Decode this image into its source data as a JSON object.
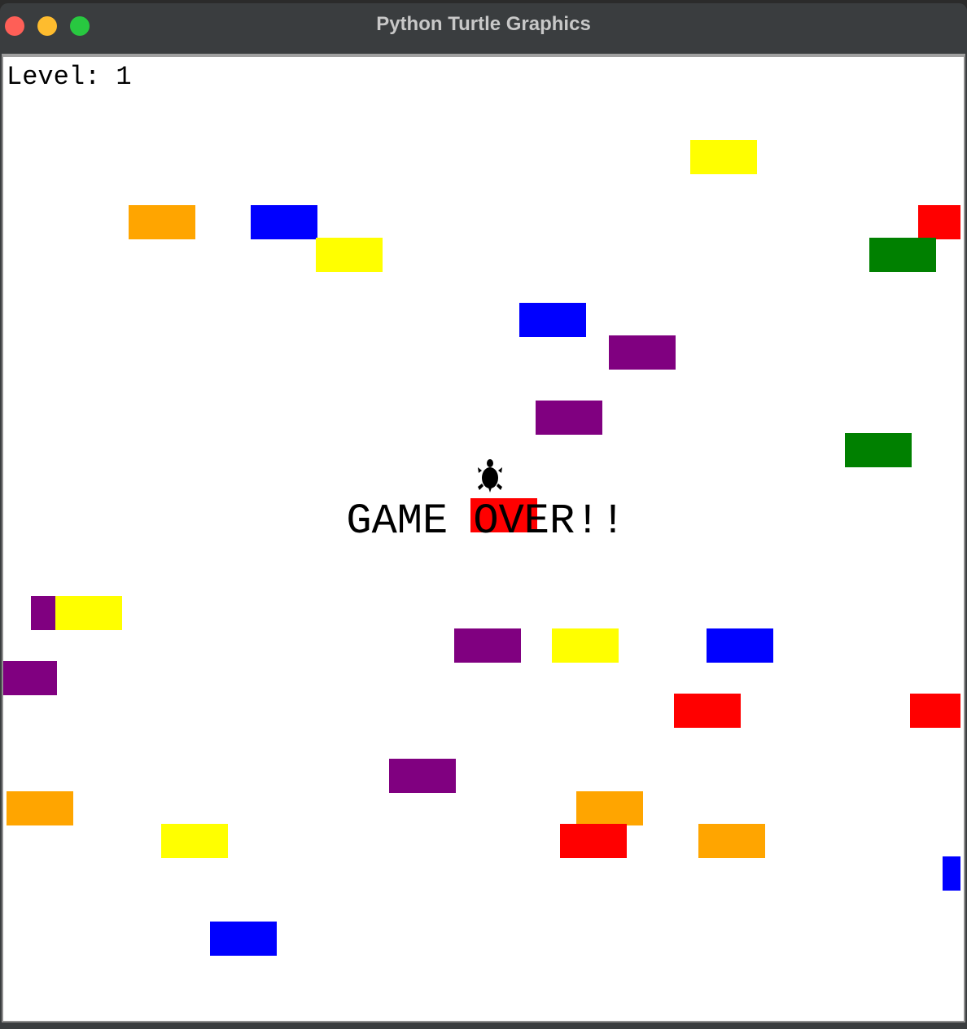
{
  "window": {
    "title": "Python Turtle Graphics",
    "buttons": [
      "close-button",
      "minimize-button",
      "zoom-button"
    ]
  },
  "hud": {
    "level_label": "Level: 1"
  },
  "overlay": {
    "message": "GAME OVER!!"
  },
  "player": {
    "icon": "turtle-icon",
    "color": "#000000"
  },
  "palette": {
    "yellow": "#ffff00",
    "orange": "#ffa500",
    "blue": "#0000ff",
    "red": "#ff0000",
    "green": "#008000",
    "purple": "#800080"
  },
  "bricks": [
    {
      "color": "yellow"
    },
    {
      "color": "orange"
    },
    {
      "color": "blue"
    },
    {
      "color": "red"
    },
    {
      "color": "yellow"
    },
    {
      "color": "green"
    },
    {
      "color": "blue"
    },
    {
      "color": "purple"
    },
    {
      "color": "purple"
    },
    {
      "color": "green"
    },
    {
      "color": "red"
    },
    {
      "color": "purple"
    },
    {
      "color": "yellow"
    },
    {
      "color": "purple"
    },
    {
      "color": "yellow"
    },
    {
      "color": "blue"
    },
    {
      "color": "purple"
    },
    {
      "color": "red"
    },
    {
      "color": "red"
    },
    {
      "color": "purple"
    },
    {
      "color": "orange"
    },
    {
      "color": "orange"
    },
    {
      "color": "yellow"
    },
    {
      "color": "red"
    },
    {
      "color": "orange"
    },
    {
      "color": "blue"
    },
    {
      "color": "blue"
    }
  ]
}
